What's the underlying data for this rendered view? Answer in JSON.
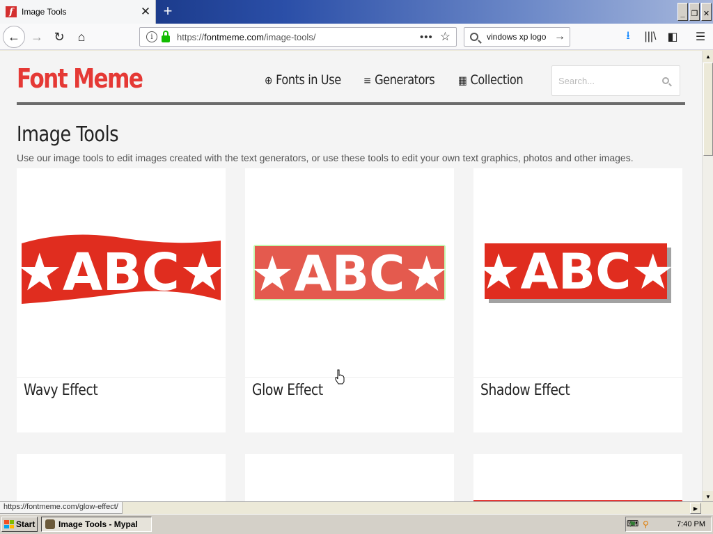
{
  "browser": {
    "tab_title": "Image Tools",
    "favicon_letter": "f",
    "new_tab_symbol": "+",
    "close_symbol": "✕",
    "url_prefix": "https://",
    "url_host": "fontmeme.com",
    "url_path": "/image-tools/",
    "search_query": "vindows xp logo",
    "status_url": "https://fontmeme.com/glow-effect/"
  },
  "site": {
    "logo": "Font Meme",
    "logo_color": "#e53935",
    "nav": [
      {
        "label": "Fonts in Use",
        "icon": "target-icon"
      },
      {
        "label": "Generators",
        "icon": "edit-list-icon"
      },
      {
        "label": "Collection",
        "icon": "grid-icon"
      }
    ],
    "search_placeholder": "Search..."
  },
  "page": {
    "title": "Image Tools",
    "description": "Use our image tools to edit images created with the text generators, or use these tools to edit your own text graphics, photos and other images."
  },
  "cards": [
    {
      "label": "Wavy Effect",
      "graphic_text": "★ABC★",
      "effect": "wavy"
    },
    {
      "label": "Glow Effect",
      "graphic_text": "★ABC★",
      "effect": "glow"
    },
    {
      "label": "Shadow Effect",
      "graphic_text": "★ABC★",
      "effect": "shadow"
    }
  ],
  "taskbar": {
    "start_label": "Start",
    "task_label": "Image Tools - Mypal",
    "clock": "7:40 PM"
  }
}
